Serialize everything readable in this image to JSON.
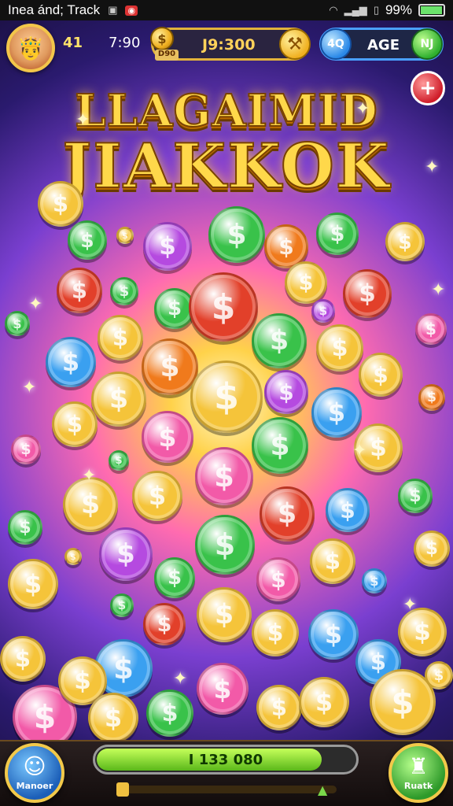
{
  "status_bar": {
    "title": "Inea ánd; Track",
    "battery": "99%",
    "battery_level": 0.95
  },
  "hud": {
    "level": "41",
    "clock": "7:90",
    "coins": {
      "amount": "J9:300",
      "bonus": "D90",
      "add_glyph": "⚒"
    },
    "gems": {
      "badge": "4Q",
      "label": "AGE",
      "add_badge": "NJ"
    },
    "close_glyph": "+"
  },
  "title": {
    "line1": "LLAGAIMID",
    "line2": "JIAKKOK"
  },
  "bottom": {
    "left_button": "Manoer",
    "right_button": "Ruatk",
    "progress_text": "I 133 080",
    "progress_fraction": 0.86
  },
  "colors": {
    "gold": "#f5c43a",
    "green": "#39c24a",
    "red": "#e2402a",
    "orange": "#f07a1c",
    "pink": "#f25aa8",
    "purple": "#b54ae0",
    "blue": "#3aa0f0"
  }
}
